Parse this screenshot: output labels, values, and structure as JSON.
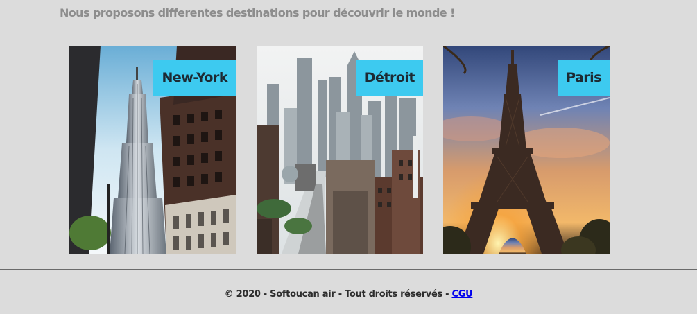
{
  "intro": {
    "text": "Nous proposons differentes destinations pour découvrir le monde !"
  },
  "destinations": [
    {
      "label": "New-York",
      "image": "empire-state-building-photo"
    },
    {
      "label": "Détroit",
      "image": "detroit-skyline-photo"
    },
    {
      "label": "Paris",
      "image": "eiffel-tower-sunset-photo"
    }
  ],
  "footer": {
    "text": "© 2020 - Softoucan air - Tout droits réservés - ",
    "link_label": "CGU"
  },
  "colors": {
    "background": "#dcdcdc",
    "badge": "#3dcaf0",
    "link": "#0000ee"
  }
}
